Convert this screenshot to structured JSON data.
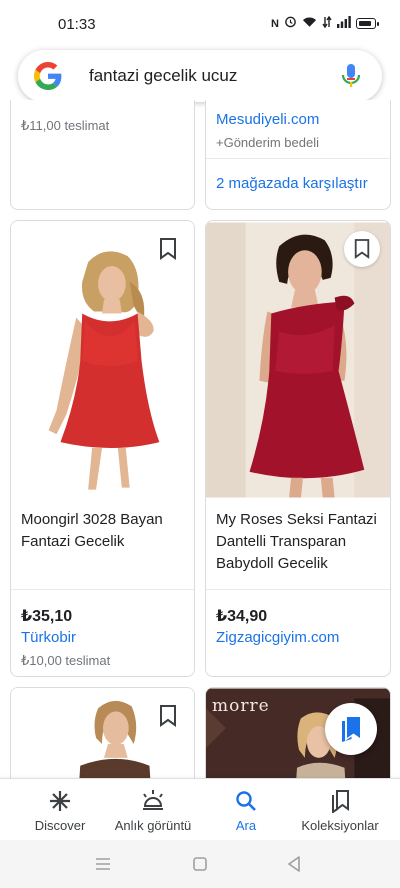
{
  "status_bar": {
    "time": "01:33"
  },
  "search": {
    "query": "fantazi gecelik ucuz"
  },
  "colors": {
    "link": "#1a73e8",
    "google_blue": "#4285f4",
    "google_red": "#ea4335",
    "google_yellow": "#fbbc05",
    "google_green": "#34a853"
  },
  "top_cards": {
    "left": {
      "shipping": "₺11,00 teslimat"
    },
    "right": {
      "merchant": "Mesudiyeli.com",
      "shipping": "+Gönderim bedeli",
      "compare": "2 mağazada karşılaştır"
    }
  },
  "products": [
    {
      "title_line1": "Moongirl 3028 Bayan",
      "title_line2": "Fantazi Gecelik",
      "price": "₺35,10",
      "merchant": "Türkobir",
      "shipping": "₺10,00 teslimat"
    },
    {
      "title_line1": "My Roses Seksi Fantazi",
      "title_line2": "Dantelli Transparan",
      "title_line3": "Babydoll Gecelik",
      "price": "₺34,90",
      "merchant": "Zigzagicgiyim.com"
    }
  ],
  "bottom_cards": {
    "right_brand": "morre"
  },
  "bottom_nav": [
    {
      "label": "Discover",
      "icon": "asterisk-icon"
    },
    {
      "label": "Anlık görüntü",
      "icon": "snapshot-icon"
    },
    {
      "label": "Ara",
      "icon": "search-icon"
    },
    {
      "label": "Koleksiyonlar",
      "icon": "collections-icon"
    }
  ]
}
